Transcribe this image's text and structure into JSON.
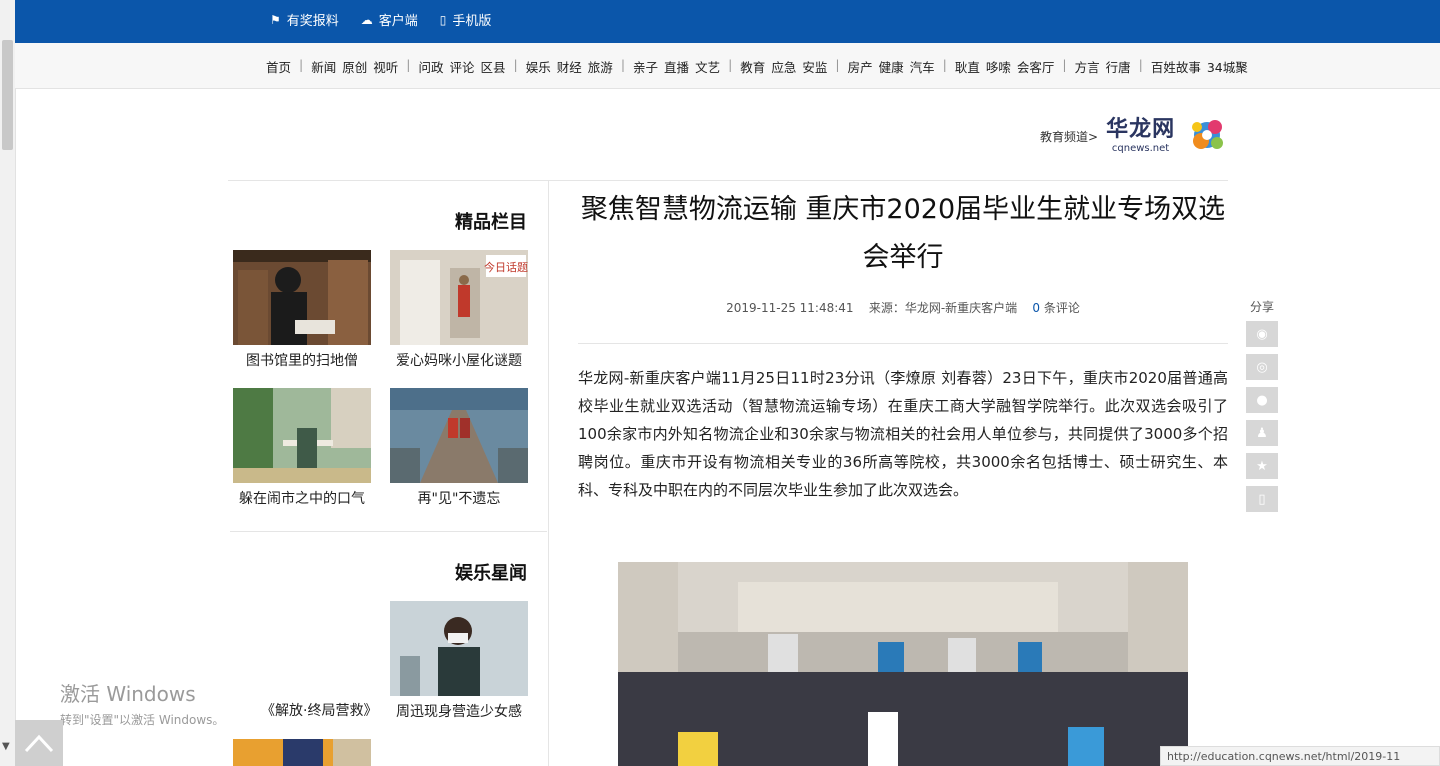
{
  "top_links": [
    {
      "icon": "flag-icon",
      "label": "有奖报料"
    },
    {
      "icon": "cloud-icon",
      "label": "客户端"
    },
    {
      "icon": "mobile-icon",
      "label": "手机版"
    }
  ],
  "nav": [
    "首页",
    "新闻",
    "原创",
    "视听",
    "问政",
    "评论",
    "区县",
    "娱乐",
    "财经",
    "旅游",
    "亲子",
    "直播",
    "文艺",
    "教育",
    "应急",
    "安监",
    "房产",
    "健康",
    "汽车",
    "耿直",
    "哆嗦",
    "会客厅",
    "方言",
    "行唐",
    "百姓故事",
    "34城聚"
  ],
  "logo": {
    "cn": "华龙网",
    "en": "cqnews.net",
    "channel": "教育频道>"
  },
  "sidebar": {
    "section1": "精品栏目",
    "cards1": [
      {
        "caption": "爱心妈咪小屋化谜题"
      },
      {
        "caption": "图书馆里的扫地僧"
      },
      {
        "caption": "再\"见\"不遗忘"
      },
      {
        "caption": "躲在闹市之中的口气"
      }
    ],
    "section2": "娱乐星闻",
    "card2_caption": "周迅现身营造少女感",
    "link2": "《解放·终局营救》"
  },
  "article": {
    "headline": "聚焦智慧物流运输 重庆市2020届毕业生就业专场双选会举行",
    "date": "2019-11-25 11:48:41",
    "source": "来源：华龙网-新重庆客户端",
    "comment_count": "0",
    "comment_label": "条评论",
    "paragraph": "华龙网-新重庆客户端11月25日11时23分讯（李燎原 刘春蓉）23日下午，重庆市2020届普通高校毕业生就业双选活动（智慧物流运输专场）在重庆工商大学融智学院举行。此次双选会吸引了100余家市内外知名物流企业和30余家与物流相关的社会用人单位参与，共同提供了3000多个招聘岗位。重庆市开设有物流相关专业的36所高等院校，共3000余名包括博士、硕士研究生、本科、专科及中职在内的不同层次毕业生参加了此次双选会。"
  },
  "share": {
    "label": "分享",
    "buttons": [
      "weibo-icon",
      "tencent-weibo-icon",
      "wechat-icon",
      "qq-icon",
      "favorite-star-icon",
      "phone-icon"
    ]
  },
  "watermark": {
    "title": "激活 Windows",
    "subtitle": "转到\"设置\"以激活 Windows。"
  },
  "statusbar": "http://education.cqnews.net/html/2019-11"
}
